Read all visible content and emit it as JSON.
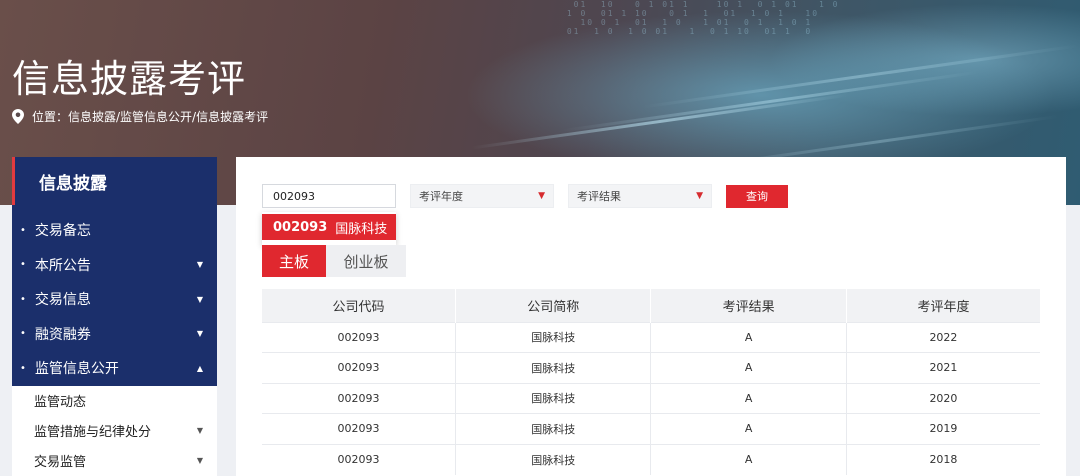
{
  "banner": {
    "title": "信息披露考评",
    "location_label": "位置：",
    "breadcrumb": "信息披露/监管信息公开/信息披露考评"
  },
  "sidebar": {
    "header": "信息披露",
    "items": [
      {
        "label": "交易备忘",
        "caret": ""
      },
      {
        "label": "本所公告",
        "caret": "down"
      },
      {
        "label": "交易信息",
        "caret": "down"
      },
      {
        "label": "融资融券",
        "caret": "down"
      },
      {
        "label": "监管信息公开",
        "caret": "up"
      }
    ],
    "subitems": [
      {
        "label": "监管动态",
        "caret": ""
      },
      {
        "label": "监管措施与纪律处分",
        "caret": "down"
      },
      {
        "label": "交易监管",
        "caret": "down"
      }
    ]
  },
  "filters": {
    "search_value": "002093",
    "year_placeholder": "考评年度",
    "result_placeholder": "考评结果",
    "query_label": "查询"
  },
  "suggestion": {
    "code": "002093",
    "name": "国脉科技"
  },
  "tabs": [
    {
      "label": "主板",
      "active": true
    },
    {
      "label": "创业板",
      "active": false
    }
  ],
  "table": {
    "headers": [
      "公司代码",
      "公司简称",
      "考评结果",
      "考评年度"
    ],
    "rows": [
      [
        "002093",
        "国脉科技",
        "A",
        "2022"
      ],
      [
        "002093",
        "国脉科技",
        "A",
        "2021"
      ],
      [
        "002093",
        "国脉科技",
        "A",
        "2020"
      ],
      [
        "002093",
        "国脉科技",
        "A",
        "2019"
      ],
      [
        "002093",
        "国脉科技",
        "A",
        "2018"
      ]
    ]
  },
  "colors": {
    "accent": "#e0282f",
    "sidebar_bg": "#1b2f6b"
  }
}
